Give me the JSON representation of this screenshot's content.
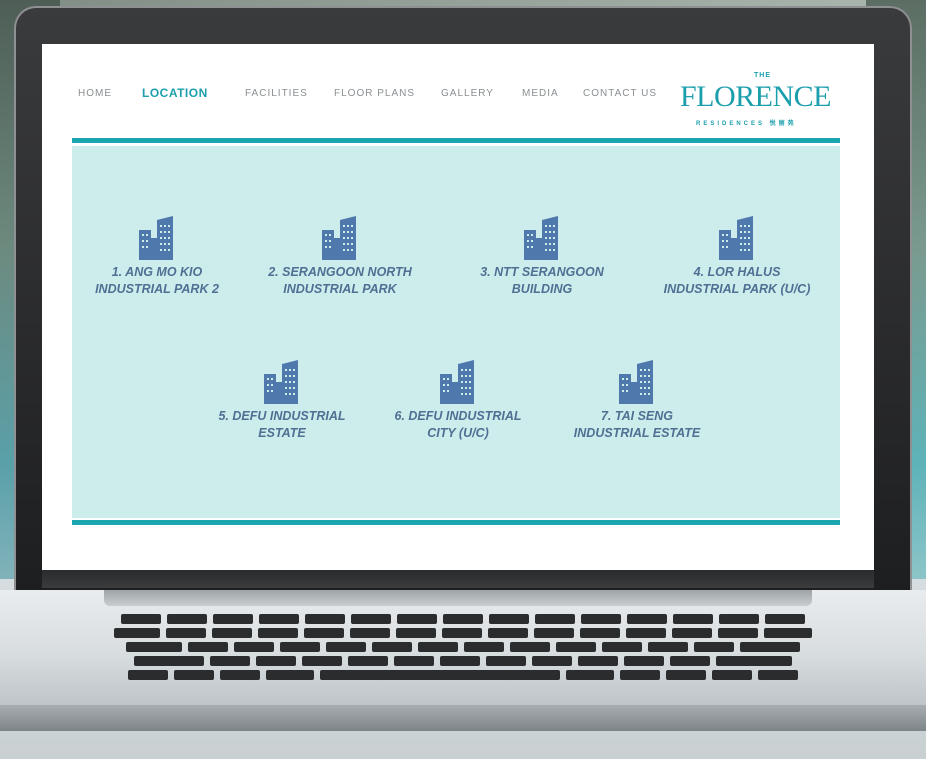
{
  "nav": {
    "items": [
      {
        "label": "HOME",
        "active": false
      },
      {
        "label": "LOCATION",
        "active": true
      },
      {
        "label": "FACILITIES",
        "active": false
      },
      {
        "label": "FLOOR PLANS",
        "active": false
      },
      {
        "label": "GALLERY",
        "active": false
      },
      {
        "label": "MEDIA",
        "active": false
      },
      {
        "label": "CONTACT US",
        "active": false
      }
    ]
  },
  "logo": {
    "prefix": "THE",
    "name": "FLORENCE",
    "tagline": "RESIDENCES 悦丽苑"
  },
  "locations": [
    {
      "label": "1. ANG MO KIO\nINDUSTRIAL PARK 2",
      "icon": "building-icon"
    },
    {
      "label": "2. SERANGOON NORTH\nINDUSTRIAL PARK",
      "icon": "building-icon"
    },
    {
      "label": "3. NTT SERANGOON\nBUILDING",
      "icon": "building-icon"
    },
    {
      "label": "4. LOR HALUS\nINDUSTRIAL PARK (U/C)",
      "icon": "building-icon"
    },
    {
      "label": "5. DEFU INDUSTRIAL\nESTATE",
      "icon": "building-icon"
    },
    {
      "label": "6. DEFU INDUSTRIAL\nCITY (U/C)",
      "icon": "building-icon"
    },
    {
      "label": "7. TAI SENG\nINDUSTRIAL ESTATE",
      "icon": "building-icon"
    }
  ],
  "colors": {
    "accent": "#1aa6ae",
    "panel": "#cdeded",
    "icon": "#4f78ad",
    "label": "#4f6f93"
  }
}
